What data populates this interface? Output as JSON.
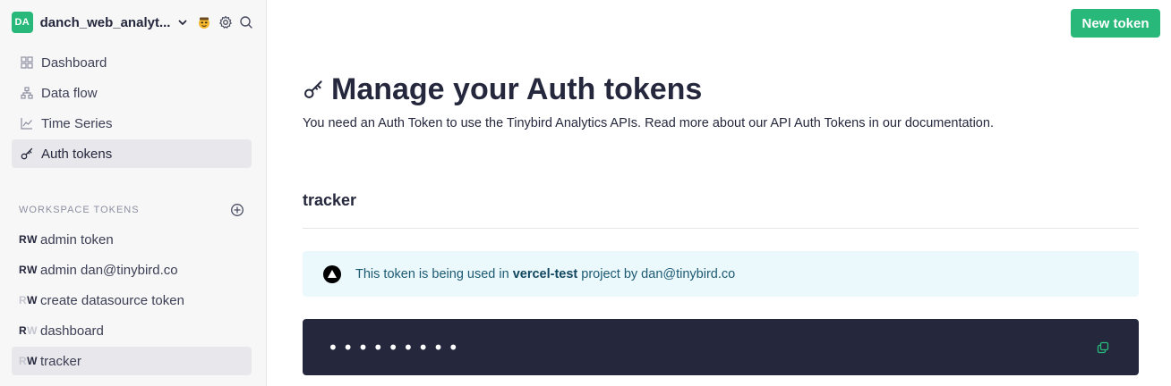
{
  "workspace": {
    "initials": "DA",
    "name": "danch_web_analyt...",
    "icons": [
      "chevron-down-icon",
      "emoji-face-icon",
      "gear-icon",
      "search-icon"
    ]
  },
  "nav": {
    "items": [
      {
        "label": "Dashboard",
        "icon": "grid-icon"
      },
      {
        "label": "Data flow",
        "icon": "dataflow-icon"
      },
      {
        "label": "Time Series",
        "icon": "chart-line-icon"
      },
      {
        "label": "Auth tokens",
        "icon": "key-icon",
        "active": true
      }
    ]
  },
  "tokens_section": {
    "label": "WORKSPACE TOKENS",
    "add_icon": "plus-circle-icon",
    "items": [
      {
        "scope_r": "R",
        "scope_w": "W",
        "label": "admin token",
        "r_on": true,
        "w_on": true
      },
      {
        "scope_r": "R",
        "scope_w": "W",
        "label": "admin dan@tinybird.co",
        "r_on": true,
        "w_on": true
      },
      {
        "scope_r": "R",
        "scope_w": "W",
        "label": "create datasource token",
        "r_on": false,
        "w_on": true
      },
      {
        "scope_r": "R",
        "scope_w": "W",
        "label": "dashboard",
        "r_on": true,
        "w_on": false
      },
      {
        "scope_r": "R",
        "scope_w": "W",
        "label": "tracker",
        "r_on": false,
        "w_on": true,
        "active": true
      }
    ]
  },
  "header": {
    "new_token_label": "New token"
  },
  "main": {
    "title": "Manage your Auth tokens",
    "title_icon": "key-icon",
    "description": "You need an Auth Token to use the Tinybird Analytics APIs. Read more about our API Auth Tokens in our documentation.",
    "token_name": "tracker",
    "info": {
      "icon": "vercel-icon",
      "text_before": "This token is being used in ",
      "project": "vercel-test",
      "text_after": " project by dan@tinybird.co"
    },
    "token_masked": "•••••••••",
    "copy_icon": "copy-icon"
  },
  "colors": {
    "accent": "#27b87a",
    "dark": "#25283d",
    "info_bg": "#ebf8fc"
  }
}
